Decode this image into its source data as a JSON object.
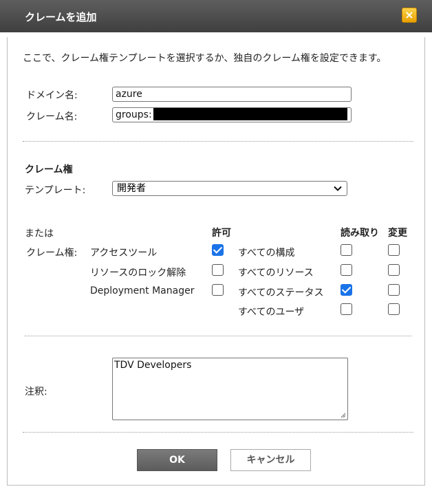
{
  "dialog": {
    "title": "クレームを追加",
    "close_label": "×",
    "intro": "ここで、クレーム権テンプレートを選択するか、独自のクレーム権を設定できます。"
  },
  "fields": {
    "domain_label": "ドメイン名:",
    "domain_value": "azure",
    "claim_label": "クレーム名:",
    "claim_value_prefix": "groups:"
  },
  "rights": {
    "heading": "クレーム権",
    "template_label": "テンプレート:",
    "template_selected": "開発者",
    "or_label": "または",
    "claim_rights_label": "クレーム権:",
    "allow_header": "許可",
    "read_header": "読み取り",
    "change_header": "変更",
    "allow_items": [
      {
        "label": "アクセスツール",
        "checked": true
      },
      {
        "label": "リソースのロック解除",
        "checked": false
      },
      {
        "label": "Deployment Manager",
        "checked": false
      }
    ],
    "rw_items": [
      {
        "label": "すべての構成",
        "read": false,
        "change": false
      },
      {
        "label": "すべてのリソース",
        "read": false,
        "change": false
      },
      {
        "label": "すべてのステータス",
        "read": true,
        "change": false
      },
      {
        "label": "すべてのユーザ",
        "read": false,
        "change": false
      }
    ]
  },
  "notes": {
    "label": "注釈:",
    "value": "TDV Developers"
  },
  "buttons": {
    "ok": "OK",
    "cancel": "キャンセル"
  }
}
